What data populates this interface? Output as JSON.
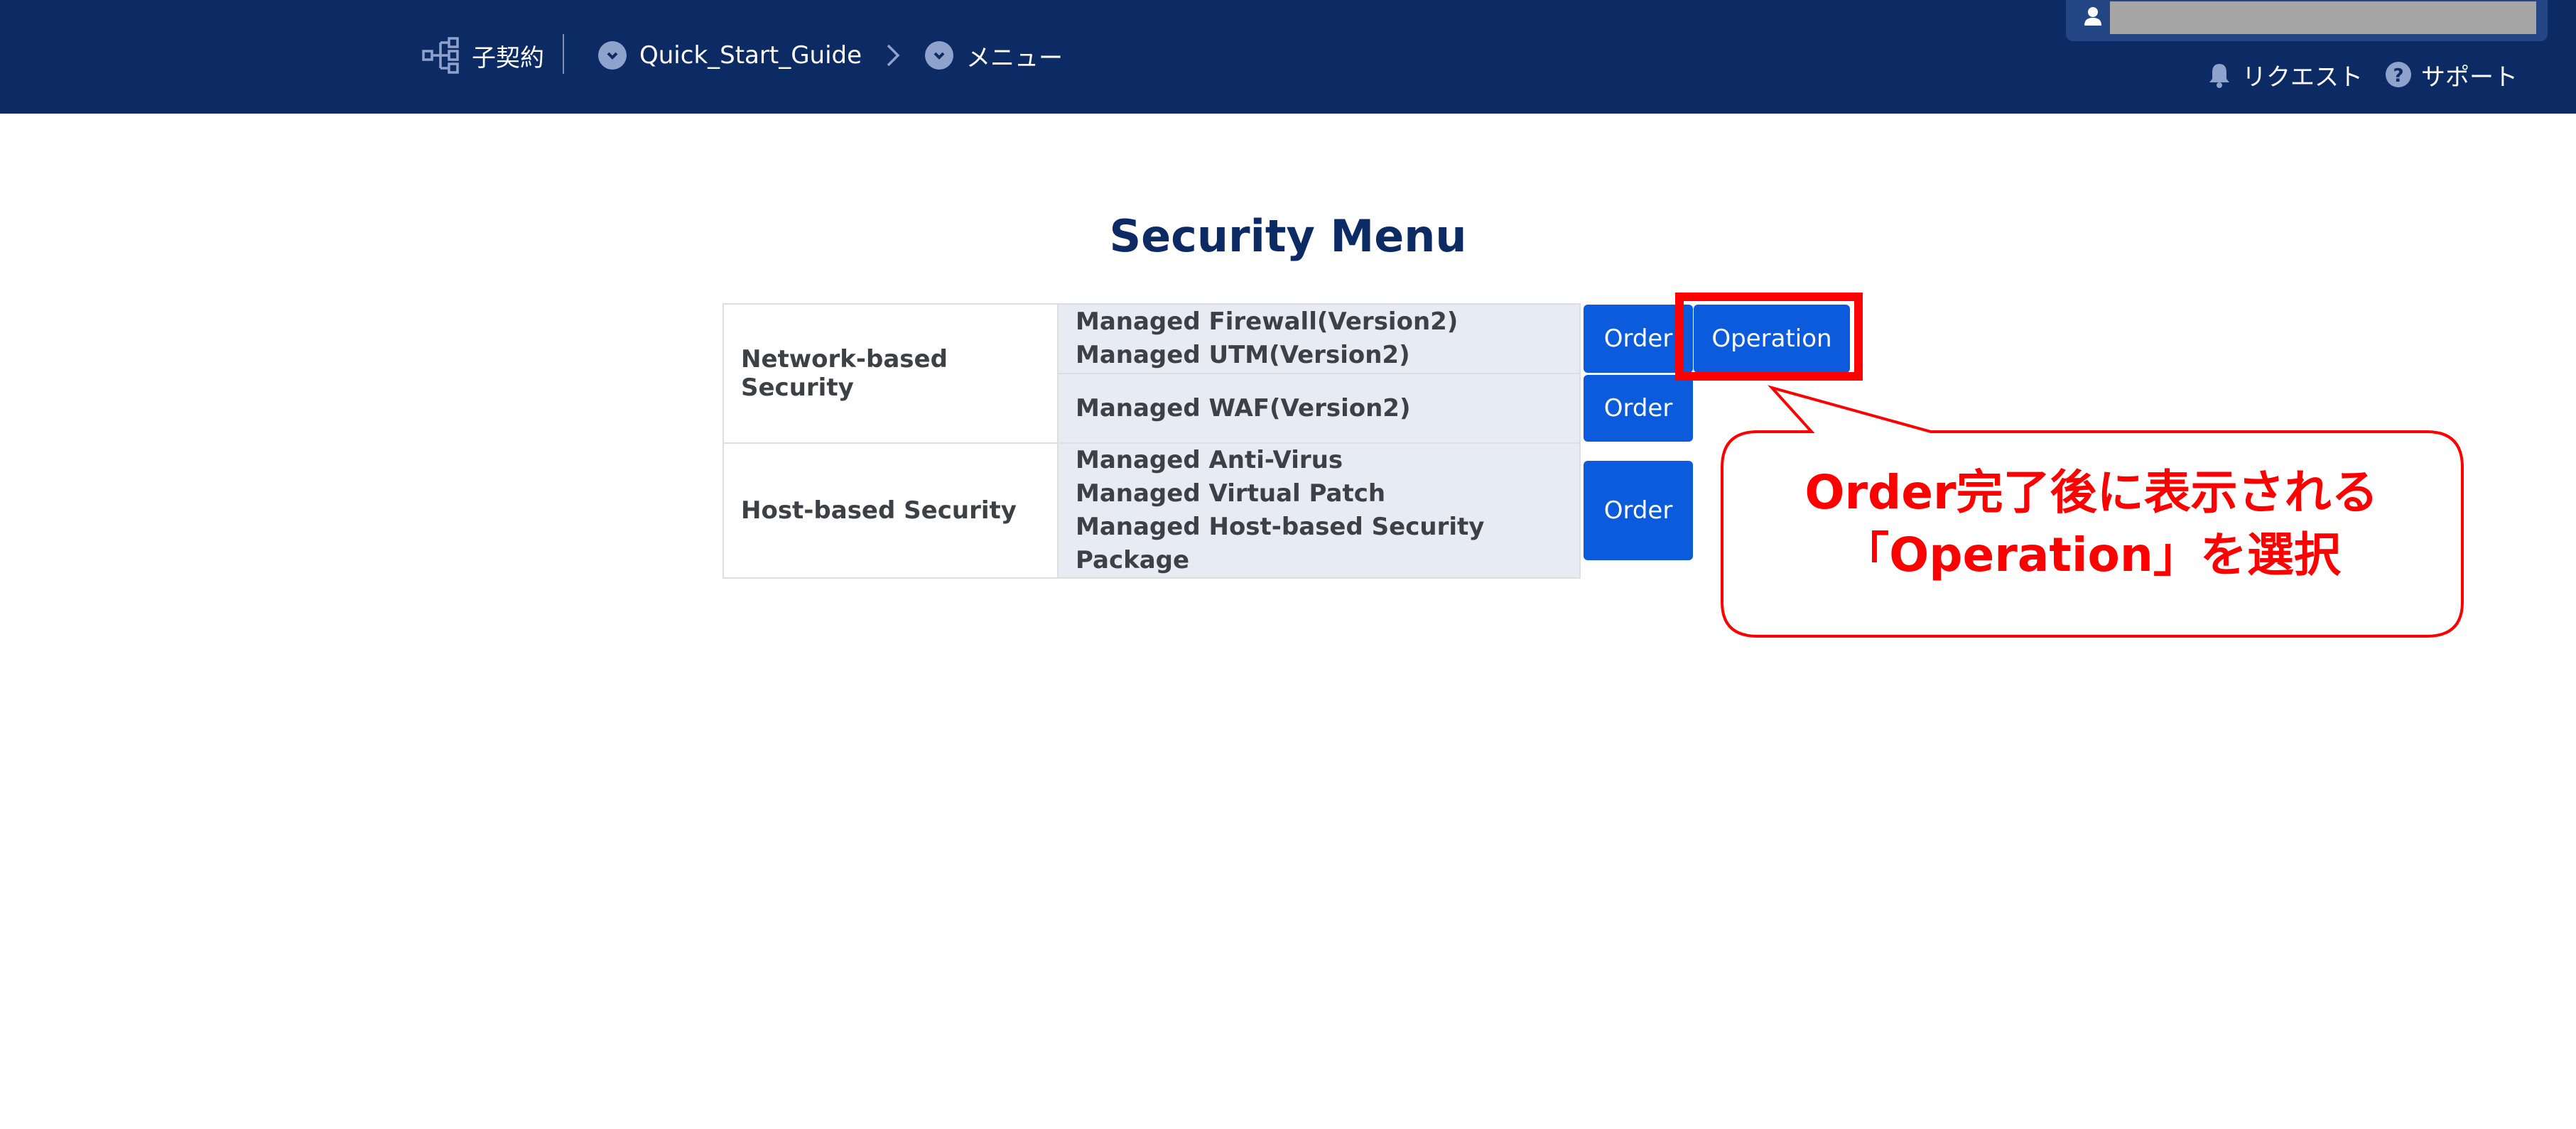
{
  "header": {
    "contract_label": "子契約",
    "guide_label": "Quick_Start_Guide",
    "menu_label": "メニュー",
    "request_label": "リクエスト",
    "support_label": "サポート"
  },
  "page": {
    "title": "Security Menu"
  },
  "table": {
    "rows": [
      {
        "category": "Network-based Security",
        "services": [
          {
            "lines": [
              "Managed Firewall(Version2)",
              "Managed UTM(Version2)"
            ],
            "order_label": "Order",
            "operation_label": "Operation"
          },
          {
            "lines": [
              "Managed WAF(Version2)"
            ],
            "order_label": "Order"
          }
        ]
      },
      {
        "category": "Host-based Security",
        "services": [
          {
            "lines": [
              "Managed Anti-Virus",
              "Managed Virtual Patch",
              "Managed Host-based Security Package"
            ],
            "order_label": "Order"
          }
        ]
      }
    ]
  },
  "annotation": {
    "line1": "Order完了後に表示される",
    "line2": "「Operation」を選択"
  },
  "colors": {
    "header_bg": "#0c2a63",
    "button": "#0b5bdc",
    "highlight": "#ff0000"
  }
}
